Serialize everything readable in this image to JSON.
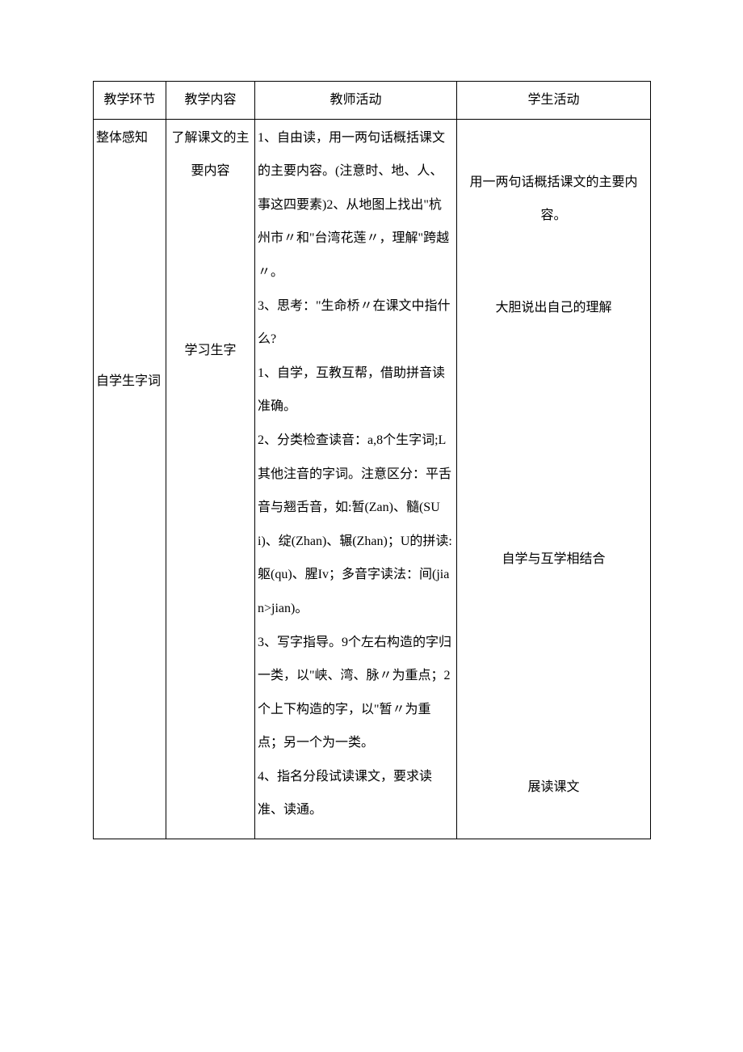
{
  "headers": {
    "c1": "教学环节",
    "c2": "教学内容",
    "c3": "教师活动",
    "c4": "学生活动"
  },
  "row": {
    "col1": {
      "p1": "整体感知",
      "p2": "自学生字词"
    },
    "col2": {
      "p1": "了解课文的主要内容",
      "p2": "学习生字"
    },
    "col3": {
      "p1": "1、自由读，用一两句话概括课文的主要内容。(注意时、地、人、事这四要素)2、从地图上找出\"杭州市〃和\"台湾花莲〃，理解\"跨越〃。",
      "p2": "3、思考：\"生命桥〃在课文中指什么?",
      "p3": "1、自学，互教互帮，借助拼音读准确。",
      "p4": "2、分类检查读音：a,8个生字词;L其他注音的字词。注意区分：平舌音与翘舌音，如:暂(Zan)、髓(SUi)、绽(Zhan)、辗(Zhan)；U的拼读:躯(qu)、腥Iv；多音字读法：间(jian>jian)。",
      "p5": "3、写字指导。9个左右构造的字归一类，以\"峡、湾、脉〃为重点；2个上下构造的字，以\"暂〃为重点；另一个为一类。",
      "p6": "4、指名分段试读课文，要求读准、读通。"
    },
    "col4": {
      "p1": "用一两句话概括课文的主要内容。",
      "p2": "大胆说出自己的理解",
      "p3": "自学与互学相结合",
      "p4": "展读课文"
    }
  }
}
